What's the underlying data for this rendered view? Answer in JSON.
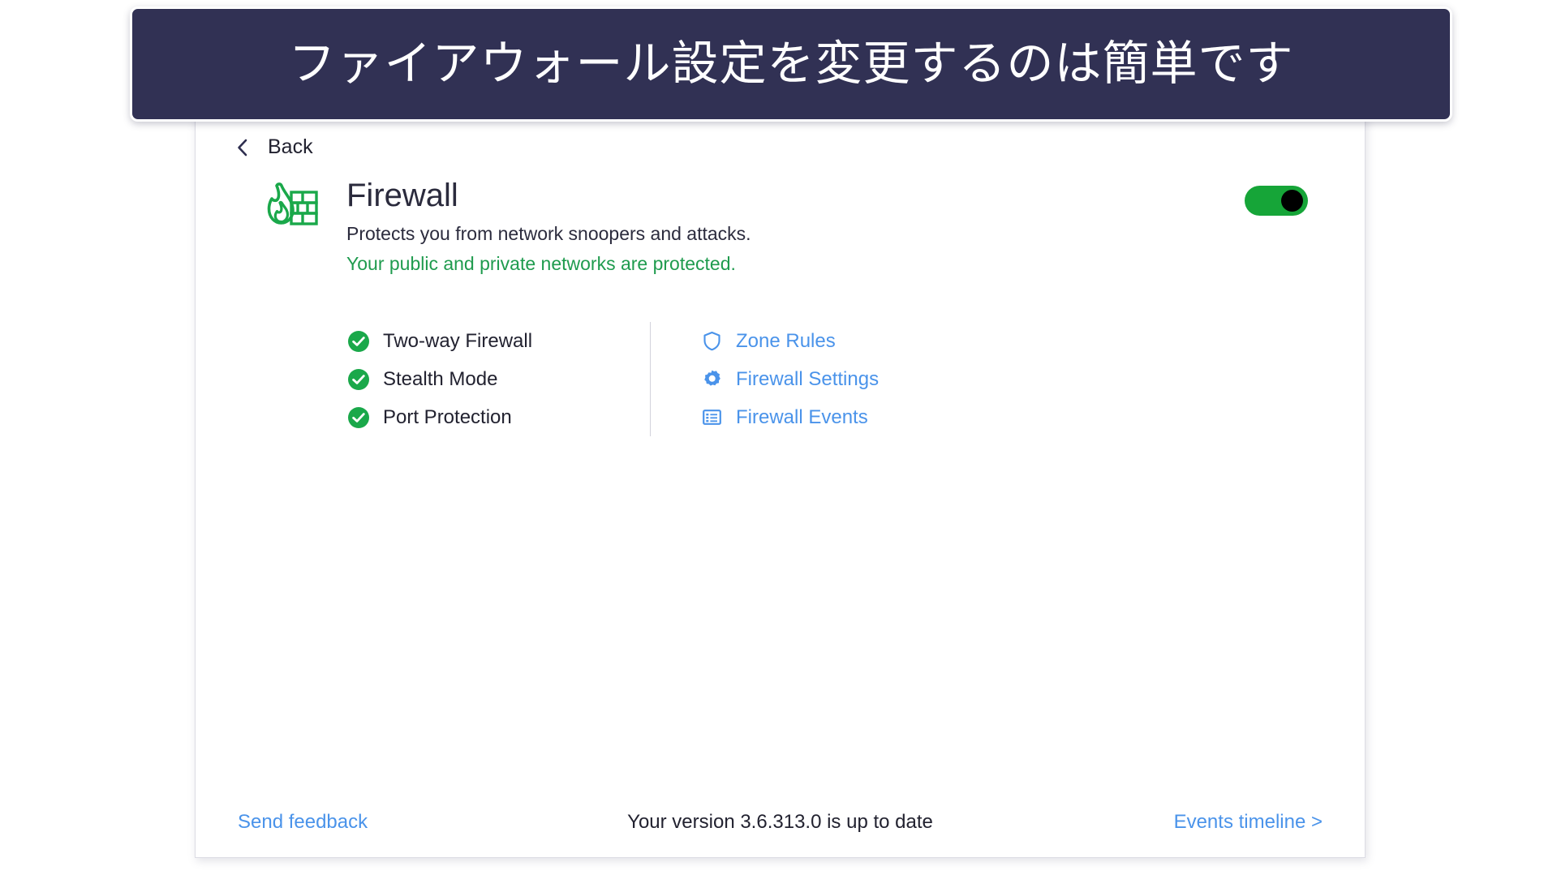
{
  "banner": {
    "text": "ファイアウォール設定を変更するのは簡単です",
    "background_color": "#313154",
    "text_color": "#ffffff"
  },
  "nav": {
    "back_label": "Back",
    "back_icon": "chevron-left-icon"
  },
  "header": {
    "icon": "firewall-flame-brickwall-icon",
    "icon_color": "#1AA84A",
    "title": "Firewall",
    "subtitle": "Protects you from network snoopers and attacks.",
    "status": "Your public and private networks are protected.",
    "status_color": "#1f9b4e"
  },
  "toggle": {
    "name": "firewall-toggle",
    "state": "on",
    "track_color": "#16a538",
    "knob_color": "#000000"
  },
  "features": [
    {
      "label": "Two-way Firewall",
      "icon": "check-circle-icon",
      "icon_color": "#1AA84A",
      "enabled": true
    },
    {
      "label": "Stealth Mode",
      "icon": "check-circle-icon",
      "icon_color": "#1AA84A",
      "enabled": true
    },
    {
      "label": "Port Protection",
      "icon": "check-circle-icon",
      "icon_color": "#1AA84A",
      "enabled": true
    }
  ],
  "links": [
    {
      "label": "Zone Rules",
      "icon": "shield-icon",
      "color": "#4a93ea"
    },
    {
      "label": "Firewall Settings",
      "icon": "gear-icon",
      "color": "#4a93ea"
    },
    {
      "label": "Firewall Events",
      "icon": "list-icon",
      "color": "#4a93ea"
    }
  ],
  "footer": {
    "send_feedback": "Send feedback",
    "version_status": "Your version 3.6.313.0 is up to date",
    "events_timeline": "Events timeline >",
    "link_color": "#4a93ea"
  }
}
